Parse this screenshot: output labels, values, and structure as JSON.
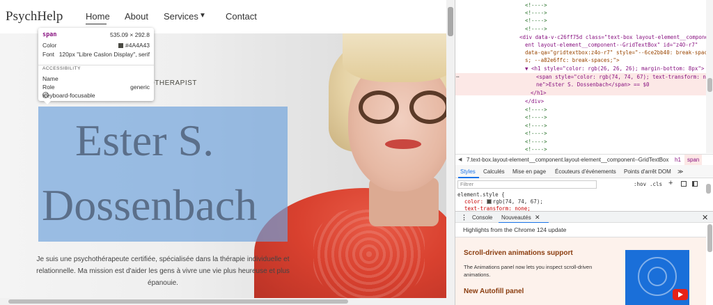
{
  "site": {
    "logo": "PsychHelp",
    "nav": {
      "home": "Home",
      "about": "About",
      "services": "Services",
      "services_caret": "▼",
      "contact": "Contact"
    },
    "eyebrow": "OTHERAPIST",
    "name_line_1": "Ester S.",
    "name_line_2": "Dossenbach",
    "intro": "Je suis une psychothérapeute certifiée, spécialisée dans la thérapie individuelle et relationnelle. Ma mission est d'aider les gens à vivre une vie plus heureuse et plus épanouie."
  },
  "tooltip": {
    "tag": "span",
    "size": "535.09 × 292.8",
    "color_label": "Color",
    "color_value": "#4A4A43",
    "font_label": "Font",
    "font_value": "120px \"Libre Caslon Display\", serif",
    "section": "ACCESSIBILITY",
    "name_label": "Name",
    "role_label": "Role",
    "role_value": "generic",
    "keyboard_label": "Keyboard-focusable"
  },
  "devtools": {
    "comment": "<!---->",
    "div_line_1": "<div data-v-c26ff75d class=\"text-box layout-element__component",
    "div_line_2": "ent layout-element__component--GridTextBox\" id=\"z4O-r7\"",
    "div_line_3": "data-qa=\"gridtextbox:z4o-r7\" style=\"--6ce2bb40: break-spaces",
    "div_line_4": "s; --a82e6ffc: break-spaces;\">",
    "h1_line": "▼ <h1 style=\"color: rgb(26, 26, 26); margin-bottom: 8px\">",
    "span_line_1": "<span style=\"color: rgb(74, 74, 67); text-transform: no",
    "span_line_2": "ne\">Ester S. Dossenbach</span> == $0",
    "h1_close": "</h1>",
    "div_close": "</div>",
    "dots": "…",
    "crumb_back": "◀",
    "crumb_path": "7.text-box.layout-element__component.layout-element__component--GridTextBox",
    "crumb_h1": "h1",
    "crumb_span": "span",
    "tabs": {
      "styles": "Styles",
      "computed": "Calculés",
      "layout": "Mise en page",
      "listeners": "Écouteurs d'événements",
      "breakpoints": "Points d'arrêt DOM",
      "more": "≫"
    },
    "filter_placeholder": "Filtrer",
    "hov": ":hov",
    "cls": ".cls",
    "plus": "+",
    "rule_selector": "element.style {",
    "rule_color": "rgb(74, 74, 67);",
    "rule_color_prop": "color:",
    "rule_transform": "text-transform: none;",
    "drawer": {
      "dots": "⋮",
      "console": "Console",
      "whatsnew": "Nouveautés",
      "tab_close": "✕",
      "close": "✕"
    },
    "whatsnew": {
      "highlights": "Highlights from the Chrome 124 update",
      "title1": "Scroll-driven animations support",
      "desc1": "The Animations panel now lets you inspect scroll-driven animations.",
      "title2": "New Autofill panel"
    }
  }
}
